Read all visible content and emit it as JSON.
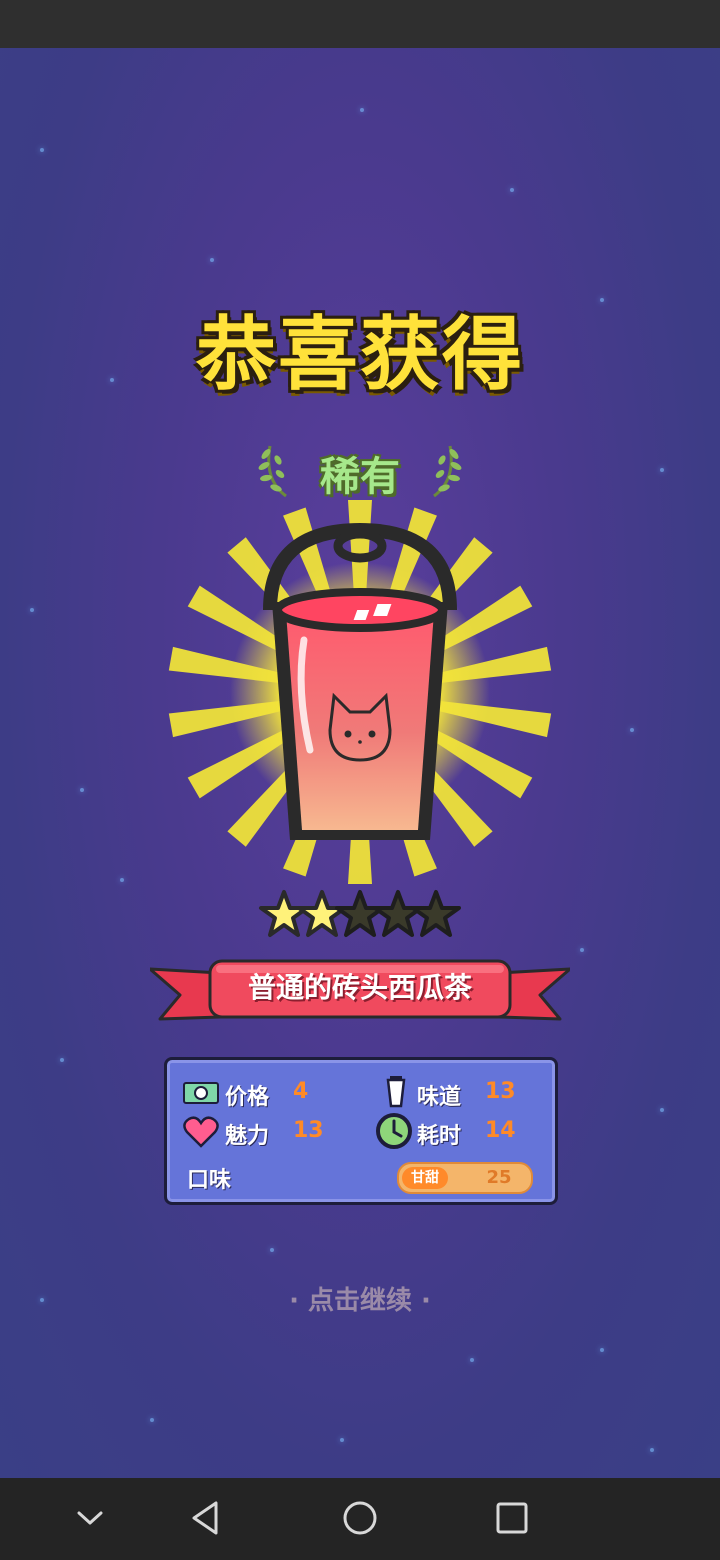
{
  "title": "恭喜获得",
  "rarity": "稀有",
  "item_name": "普通的砖头西瓜茶",
  "rating": {
    "value": 2,
    "max": 5
  },
  "stats": {
    "price_label": "价格",
    "price_value": "4",
    "taste_label": "味道",
    "taste_value": "13",
    "charm_label": "魅力",
    "charm_value": "13",
    "time_label": "耗时",
    "time_value": "14",
    "flavor_label": "口味",
    "flavor_tag": "甘甜",
    "flavor_value": "25"
  },
  "continue_text": "· 点击继续 ·",
  "colors": {
    "title": "#ffe23a",
    "rarity": "#a6e88b",
    "panel": "#6574d9",
    "value": "#ff8a26",
    "ribbon": "#e8394f"
  },
  "icons": [
    "money-icon",
    "cup-icon",
    "heart-icon",
    "clock-icon",
    "laurel-icon",
    "star-icon"
  ],
  "nav": [
    "chevron-down-icon",
    "back-triangle-icon",
    "home-circle-icon",
    "recents-square-icon"
  ]
}
